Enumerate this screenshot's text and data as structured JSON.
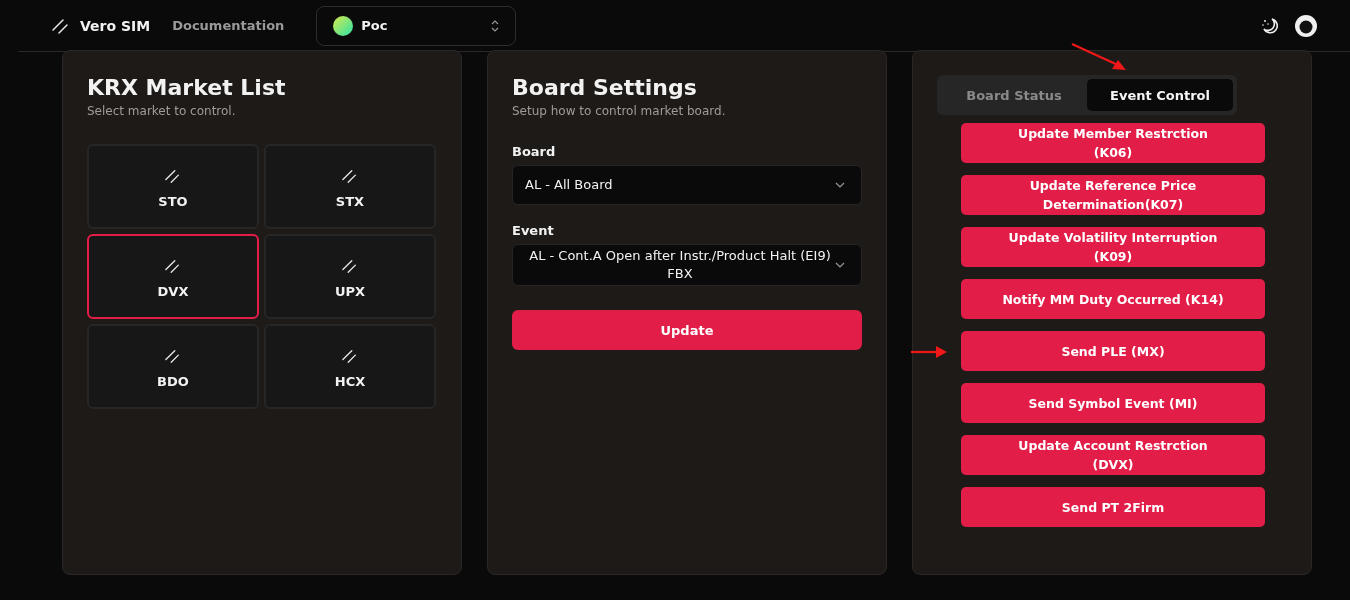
{
  "header": {
    "brand": "Vero SIM",
    "nav_link": "Documentation",
    "project_select": {
      "value": "Poc"
    }
  },
  "market_panel": {
    "title": "KRX Market List",
    "subtitle": "Select market to control.",
    "markets": [
      {
        "label": "STO",
        "selected": false
      },
      {
        "label": "STX",
        "selected": false
      },
      {
        "label": "DVX",
        "selected": true
      },
      {
        "label": "UPX",
        "selected": false
      },
      {
        "label": "BDO",
        "selected": false
      },
      {
        "label": "HCX",
        "selected": false
      }
    ]
  },
  "board_panel": {
    "title": "Board Settings",
    "subtitle": "Setup how to control market board.",
    "fields": [
      {
        "label": "Board",
        "value": "AL - All Board"
      },
      {
        "label": "Event",
        "value": "AL - Cont.A Open after Instr./Product Halt (EI9) FBX"
      }
    ],
    "button": "Update"
  },
  "control_panel": {
    "tabs": [
      {
        "label": "Board Status",
        "selected": false
      },
      {
        "label": "Event Control",
        "selected": true
      }
    ],
    "actions": [
      "Update Member Restrction (K06)",
      "Update Reference Price Determination(K07)",
      "Update Volatility Interruption (K09)",
      "Notify MM Duty Occurred (K14)",
      "Send PLE (MX)",
      "Send Symbol Event (MI)",
      "Update Account Restrction (DVX)",
      "Send PT 2Firm"
    ]
  }
}
